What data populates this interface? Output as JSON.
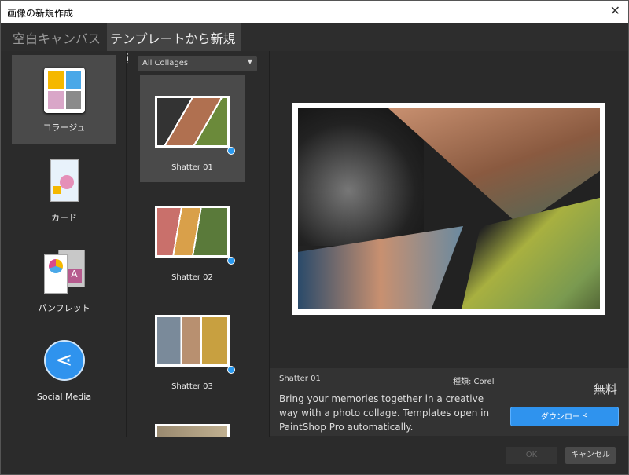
{
  "window": {
    "title": "画像の新規作成",
    "close_icon": "close-icon"
  },
  "tabs": [
    {
      "label": "空白キャンバス"
    },
    {
      "label": "テンプレートから新規作成"
    }
  ],
  "categories": [
    {
      "label": "コラージュ"
    },
    {
      "label": "カード"
    },
    {
      "label": "パンフレット"
    },
    {
      "label": "Social Media"
    }
  ],
  "filter": {
    "selected": "All Collages"
  },
  "templates": [
    {
      "label": "Shatter 01"
    },
    {
      "label": "Shatter 02"
    },
    {
      "label": "Shatter 03"
    }
  ],
  "info": {
    "name": "Shatter 01",
    "type": "種類: Corel",
    "description": "Bring your memories together in a creative way with a photo collage. Templates open in PaintShop Pro automatically.",
    "price": "無料",
    "download_label": "ダウンロード"
  },
  "footer": {
    "ok_label": "OK",
    "cancel_label": "キャンセル"
  },
  "colors": {
    "accent": "#2f93ee",
    "selected": "#4a4a4a"
  }
}
